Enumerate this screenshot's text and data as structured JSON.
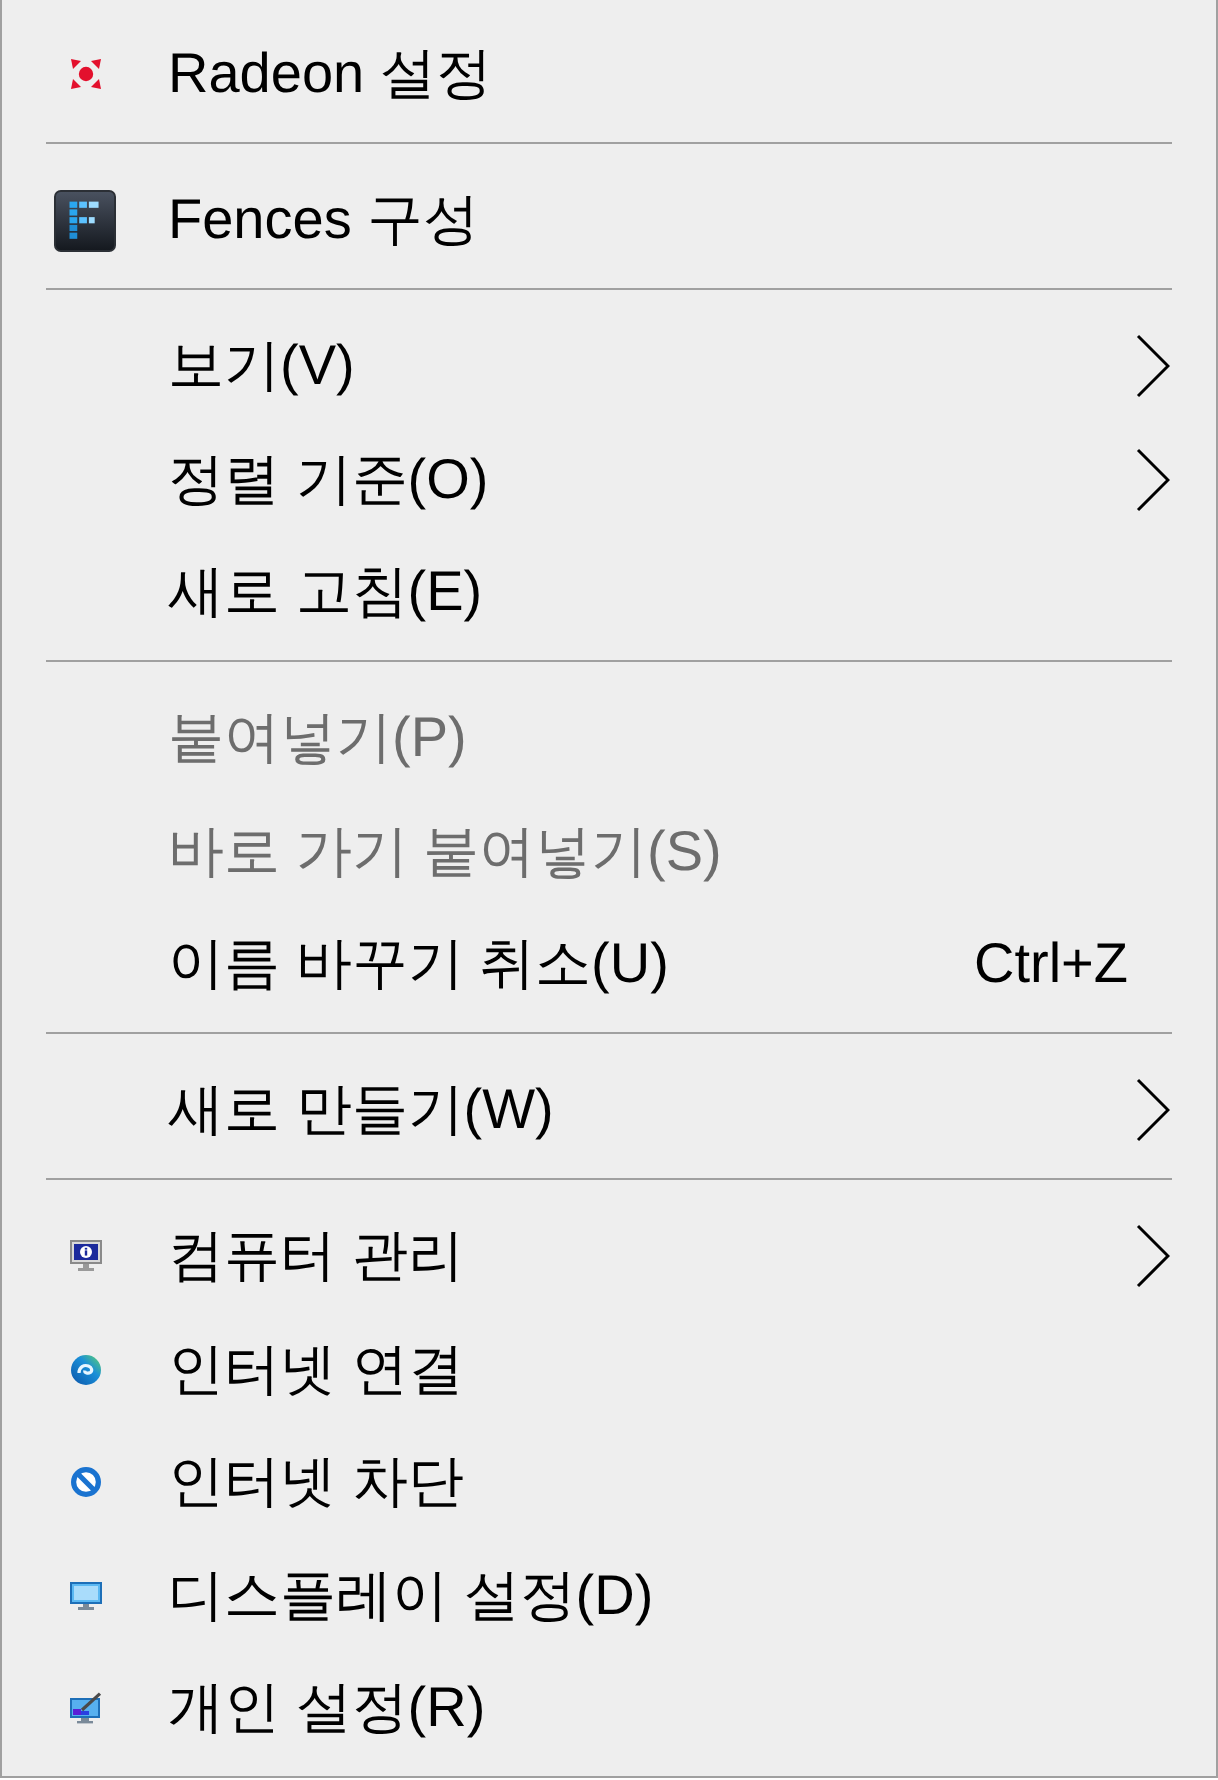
{
  "context_menu": {
    "sections": [
      {
        "items": [
          {
            "label": "Radeon 설정",
            "disabled": false,
            "has_submenu": false
          }
        ]
      },
      {
        "items": [
          {
            "label": "Fences 구성",
            "disabled": false,
            "has_submenu": false
          }
        ]
      },
      {
        "items": [
          {
            "label": "보기(V)",
            "disabled": false,
            "has_submenu": true
          },
          {
            "label": "정렬 기준(O)",
            "disabled": false,
            "has_submenu": true
          },
          {
            "label": "새로 고침(E)",
            "disabled": false,
            "has_submenu": false
          }
        ]
      },
      {
        "items": [
          {
            "label": "붙여넣기(P)",
            "disabled": true,
            "has_submenu": false
          },
          {
            "label": "바로 가기 붙여넣기(S)",
            "disabled": true,
            "has_submenu": false
          },
          {
            "label": "이름 바꾸기 취소(U)",
            "disabled": false,
            "has_submenu": false,
            "shortcut": "Ctrl+Z"
          }
        ]
      },
      {
        "items": [
          {
            "label": "새로 만들기(W)",
            "disabled": false,
            "has_submenu": true
          }
        ]
      },
      {
        "items": [
          {
            "label": "컴퓨터 관리",
            "disabled": false,
            "has_submenu": true
          },
          {
            "label": "인터넷 연결",
            "disabled": false,
            "has_submenu": false
          },
          {
            "label": "인터넷 차단",
            "disabled": false,
            "has_submenu": false
          },
          {
            "label": "디스플레이 설정(D)",
            "disabled": false,
            "has_submenu": false
          },
          {
            "label": "개인 설정(R)",
            "disabled": false,
            "has_submenu": false
          }
        ]
      }
    ]
  }
}
